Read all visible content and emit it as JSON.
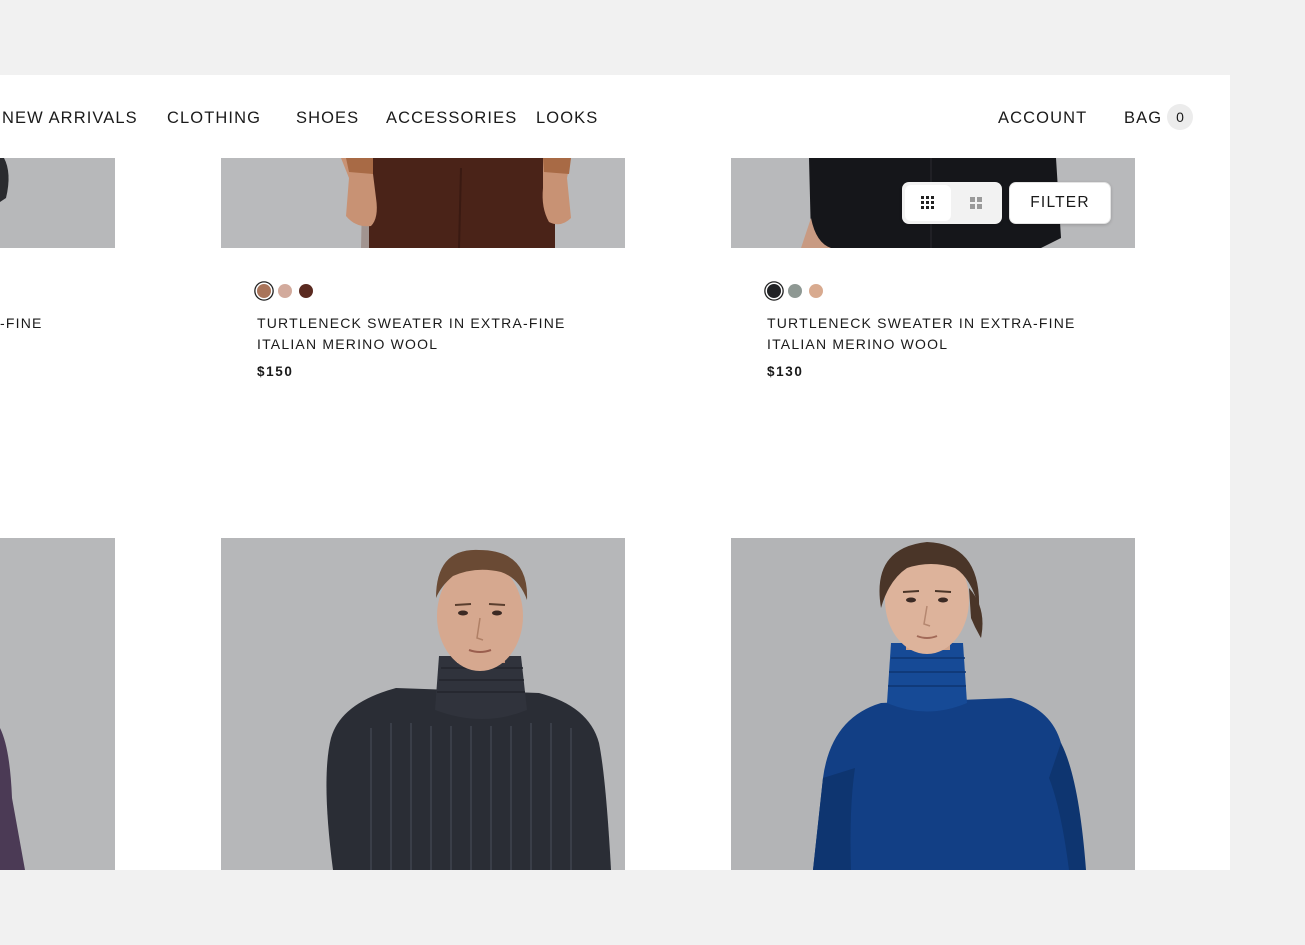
{
  "nav": {
    "items": [
      "NEW ARRIVALS",
      "CLOTHING",
      "SHOES",
      "ACCESSORIES",
      "LOOKS"
    ],
    "account": "ACCOUNT",
    "bag": "BAG",
    "bag_count": "0"
  },
  "toolbar": {
    "filter_label": "FILTER",
    "view_modes": [
      "grid-small-icon",
      "grid-large-icon"
    ],
    "active_view": "grid-small-icon"
  },
  "products_top": [
    {
      "name_partial": "-FINE"
    },
    {
      "name_line1": "TURTLENECK SWEATER IN EXTRA-FINE",
      "name_line2": "ITALIAN MERINO WOOL",
      "price": "$150",
      "swatches": [
        "#a9745a",
        "#d2aa9c",
        "#5a2a20"
      ],
      "selected_swatch": 0
    },
    {
      "name_line1": "TURTLENECK SWEATER IN EXTRA-FINE",
      "name_line2": "ITALIAN MERINO WOOL",
      "price": "$130",
      "swatches": [
        "#222326",
        "#8e9893",
        "#d8aa8f"
      ],
      "selected_swatch": 0
    }
  ],
  "colors": {
    "page_bg": "#f1f1f1",
    "panel_bg": "#ffffff",
    "photo_bg": "#b4b5b7",
    "charcoal_sweater": "#2c2f38",
    "blue_sweater": "#123f85"
  }
}
